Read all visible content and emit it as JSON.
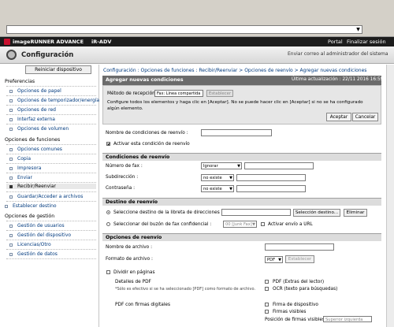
{
  "browser": {
    "address": "",
    "dropdown_glyph": "▼"
  },
  "brand": {
    "product": "imageRUNNER ADVANCE",
    "model": "iR-ADV",
    "portal": "Portal",
    "logout": "Finalizar sesión"
  },
  "config": {
    "title": "Configuración",
    "mail_admin": "Enviar correo al administrador del sistema"
  },
  "sidebar": {
    "restart": "Reiniciar dispositivo",
    "section_pref": "Preferencias",
    "pref_items": [
      "Opciones de papel",
      "Opciones de temporizador/energía",
      "Opciones de red",
      "Interfaz externa",
      "Opciones de volumen"
    ],
    "section_func": "Opciones de funciones",
    "func_items": [
      "Opciones comunes",
      "Copia",
      "Impresora",
      "Enviar",
      "Recibir/Reenviar",
      "Guardar/Acceder a archivos"
    ],
    "dest": "Establecer destino",
    "section_mgmt": "Opciones de gestión",
    "mgmt_items": [
      "Gestión de usuarios",
      "Gestión del dispositivo",
      "Licencias/Otro",
      "Gestión de datos"
    ]
  },
  "breadcrumb": "Configuración : Opciones de funciones : Recibir/Reenviar > Opciones de reenvío > Agregar nuevas condiciones",
  "header": {
    "title": "Agregar nuevas condiciones",
    "updated": "Última actualización : 22/11 2016 16:59:00"
  },
  "info": {
    "metodo_label": "Método de recepción :",
    "metodo_value": "Fax: Línea compartida",
    "establecer": "Establecer",
    "instr": "Configure todos los elementos y haga clic en [Aceptar]. No se puede hacer clic en [Aceptar] si no se ha configurado algún elemento.",
    "aceptar": "Aceptar",
    "cancelar": "Cancelar"
  },
  "form": {
    "nombre_label": "Nombre de condiciones de reenvío :",
    "nombre_value": "",
    "activar_label": "Activar esta condición de reenvío",
    "cond_title": "Condiciones de reenvío",
    "numfax_label": "Número de fax :",
    "numfax_sel": "Ignorar",
    "subdir_label": "Subdirección :",
    "subdir_sel": "no existe",
    "pwd_label": "Contraseña :",
    "pwd_sel": "no existe",
    "dest_title": "Destino de reenvío",
    "dest_opt1": "Seleccione destino de la libreta de direcciones :",
    "sel_dest_btn": "Selección destino...",
    "eliminar_btn": "Eliminar",
    "dest_opt2": "Seleccionar del buzón de fax confidencial :",
    "buzon_sel": "00 [Junk Fax]",
    "activar_url": "Activar envío a URL",
    "opc_title": "Opciones de reenvío",
    "archivo_label": "Nombre de archivo :",
    "formato_label": "Formato de archivo :",
    "formato_sel": "PDF",
    "formato_btn": "Establecer",
    "dividir": "Dividir en páginas",
    "detalles_pdf": "Detalles de PDF",
    "detalles_note": "*Sólo es efectivo si se ha seleccionado [PDF] como formato de archivo.",
    "pdf_extras": "PDF (Extras del lector)",
    "ocr": "OCR (texto para búsquedas)",
    "pdf_firmas": "PDF con firmas digitales",
    "firma_disp": "Firma de dispositivo",
    "firmas_vis": "Firmas visibles",
    "pos_firmas": "Posición de firmas visibles",
    "pos_sel": "Superior izquierda"
  }
}
